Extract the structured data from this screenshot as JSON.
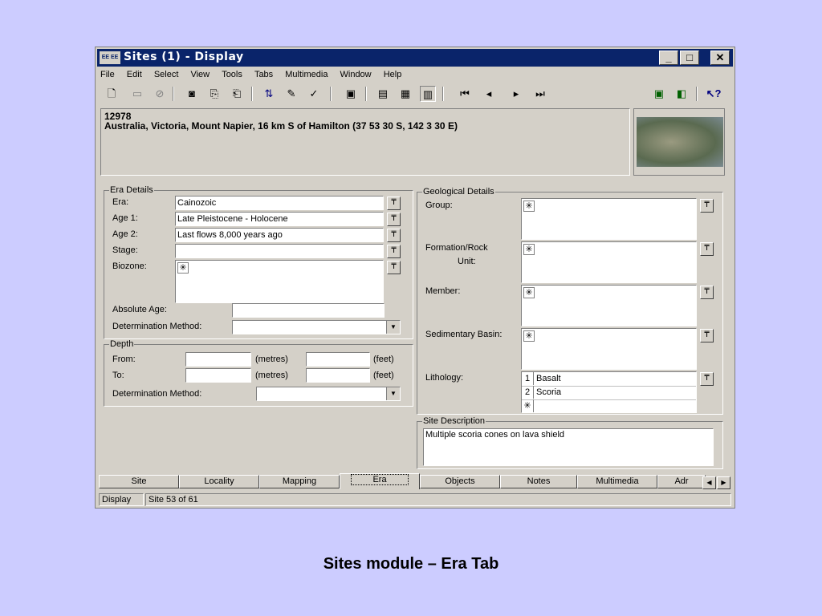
{
  "window": {
    "title": "Sites (1) - Display",
    "app_icon_text": "EE EE",
    "minimize": "_",
    "maximize": "□",
    "close": "✕"
  },
  "menu": [
    "File",
    "Edit",
    "Select",
    "View",
    "Tools",
    "Tabs",
    "Multimedia",
    "Window",
    "Help"
  ],
  "record": {
    "id": "12978",
    "locality": "Australia, Victoria, Mount Napier, 16 km S of Hamilton (37 53 30 S, 142 3 30 E)"
  },
  "era_details": {
    "legend": "Era Details",
    "era_label": "Era:",
    "era_value": "Cainozoic",
    "age1_label": "Age 1:",
    "age1_value": "Late Pleistocene - Holocene",
    "age2_label": "Age 2:",
    "age2_value": "Last flows 8,000 years ago",
    "stage_label": "Stage:",
    "stage_value": "",
    "biozone_label": "Biozone:",
    "absolute_age_label": "Absolute Age:",
    "absolute_age_value": "",
    "determination_label": "Determination Method:",
    "determination_value": ""
  },
  "depth": {
    "legend": "Depth",
    "from_label": "From:",
    "to_label": "To:",
    "metres_unit": "(metres)",
    "feet_unit": "(feet)",
    "determination_label": "Determination Method:",
    "determination_value": ""
  },
  "geological_details": {
    "legend": "Geological Details",
    "group_label": "Group:",
    "formation_label_1": "Formation/Rock",
    "formation_label_2": "Unit:",
    "member_label": "Member:",
    "basin_label": "Sedimentary Basin:",
    "lithology_label": "Lithology:",
    "lithology": [
      {
        "index": "1",
        "value": "Basalt"
      },
      {
        "index": "2",
        "value": "Scoria"
      }
    ]
  },
  "site_description": {
    "legend": "Site Description",
    "text": "Multiple scoria cones on lava shield"
  },
  "tabs": [
    "Site",
    "Locality",
    "Mapping",
    "Era",
    "Objects",
    "Notes",
    "Multimedia",
    "Adr"
  ],
  "active_tab": "Era",
  "status": {
    "mode": "Display",
    "position": "Site 53 of 61"
  },
  "caption": "Sites module – Era Tab"
}
